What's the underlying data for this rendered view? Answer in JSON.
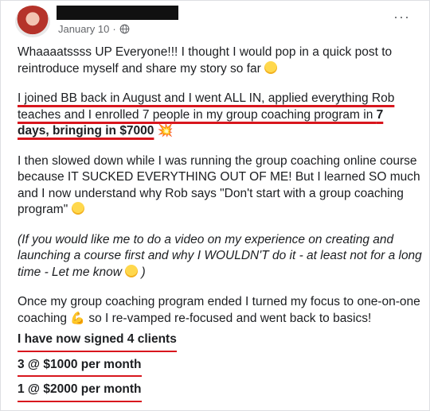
{
  "post": {
    "date": "January 10",
    "separator": "·",
    "privacy_icon": "globe-icon",
    "more_icon": "more-options-icon",
    "more_label": "···",
    "paragraphs": {
      "p1_a": "Whaaaatssss UP Everyone!!! I thought I would pop in a quick post to reintroduce myself and share my story so far",
      "p2_line1": "I joined BB back in August and I went ALL IN, applied everything Rob",
      "p2_line2": "teaches and I enrolled 7 people in my group coaching program in ",
      "p2_bold_a": "7",
      "p2_bold_b": "days, bringing in $7000",
      "p3": "I then slowed down while I was running the group coaching online course because IT SUCKED EVERYTHING OUT OF ME! But I learned SO much and I now understand why Rob says \"Don't start with a group coaching program\"",
      "p4": "(If you would like me to do a video on my experience on creating and launching a course first and why I WOULDN'T do it - at least not for a long time - Let me know",
      "p4_end": " )",
      "p5_a": "Once my group coaching program ended I turned my focus to one-on-one coaching",
      "p5_b": " so I re-vamped re-focused and went back to basics!",
      "stat1": "I have now signed 4 clients",
      "stat2": "3 @ $1000 per month",
      "stat3": "1 @ $2000 per month"
    },
    "emojis": {
      "burst": "💥",
      "muscle": "💪"
    }
  },
  "colors": {
    "underline": "#d8161d",
    "meta_text": "#65676b"
  }
}
